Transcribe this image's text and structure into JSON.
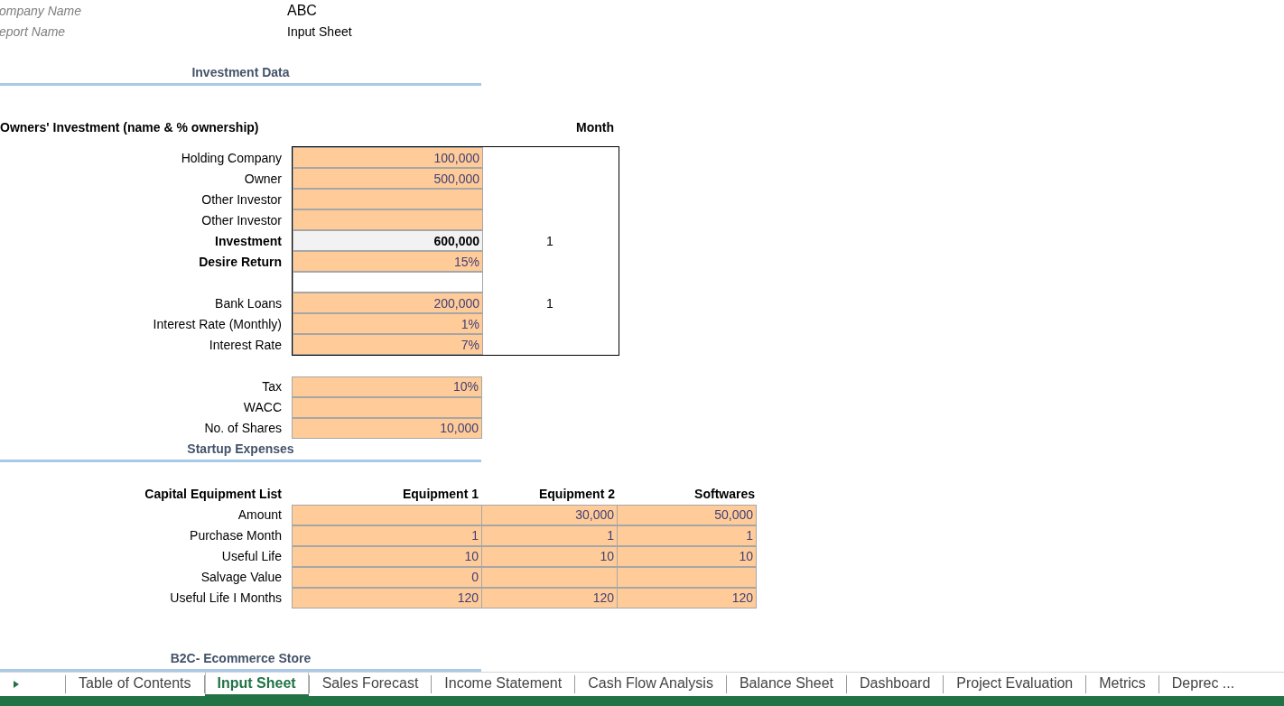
{
  "header": {
    "company_label": "ompany Name",
    "company": "ABC",
    "report_label": "eport Name",
    "report": "Input Sheet"
  },
  "investment": {
    "title": "Investment Data",
    "heading": "Owners' Investment (name & % ownership)",
    "month_heading": "Month",
    "rows": [
      {
        "kind": "input",
        "label": "Holding Company",
        "value": "100,000"
      },
      {
        "kind": "input",
        "label": "Owner",
        "value": "500,000"
      },
      {
        "kind": "input",
        "label": "Other Investor"
      },
      {
        "kind": "input",
        "label": "Other Investor"
      },
      {
        "kind": "total",
        "label": "Investment",
        "value": "600,000",
        "month": "1"
      },
      {
        "kind": "key",
        "label": "Desire Return",
        "value": "15%"
      },
      {
        "kind": "spacer"
      },
      {
        "kind": "input",
        "label": "Bank Loans",
        "value": "200,000",
        "month": "1"
      },
      {
        "kind": "input",
        "label": "Interest Rate (Monthly)",
        "value": "1%"
      },
      {
        "kind": "input",
        "label": "Interest Rate",
        "value": "7%"
      }
    ]
  },
  "other_inputs": [
    {
      "label": "Tax",
      "value": "10%"
    },
    {
      "label": "WACC"
    },
    {
      "label": "No. of Shares",
      "value": "10,000"
    }
  ],
  "startup": {
    "title": "Startup Expenses",
    "heading": "Capital Equipment List",
    "columns": [
      "Equipment 1",
      "Equipment 2",
      "Softwares"
    ],
    "rows": [
      {
        "label": "Amount",
        "cells": [
          null,
          "30,000",
          "50,000"
        ]
      },
      {
        "label": "Purchase Month",
        "cells": [
          "1",
          "1",
          "1"
        ]
      },
      {
        "label": "Useful Life",
        "cells": [
          "10",
          "10",
          "10"
        ]
      },
      {
        "label": "Salvage Value",
        "cells": [
          "0",
          null,
          null
        ]
      },
      {
        "label": "Useful Life I Months",
        "cells": [
          "120",
          "120",
          "120"
        ]
      }
    ]
  },
  "next_section": {
    "title": "B2C- Ecommerce Store"
  },
  "sheet_tabs": [
    {
      "label": "Table of Contents",
      "selected": false
    },
    {
      "label": "Input Sheet",
      "selected": true
    },
    {
      "label": "Sales Forecast",
      "selected": false
    },
    {
      "label": "Income Statement",
      "selected": false
    },
    {
      "label": "Cash Flow Analysis",
      "selected": false
    },
    {
      "label": "Balance Sheet",
      "selected": false
    },
    {
      "label": "Dashboard",
      "selected": false
    },
    {
      "label": "Project Evaluation",
      "selected": false
    },
    {
      "label": "Metrics",
      "selected": false
    },
    {
      "label": "Deprec ...",
      "selected": false
    }
  ]
}
